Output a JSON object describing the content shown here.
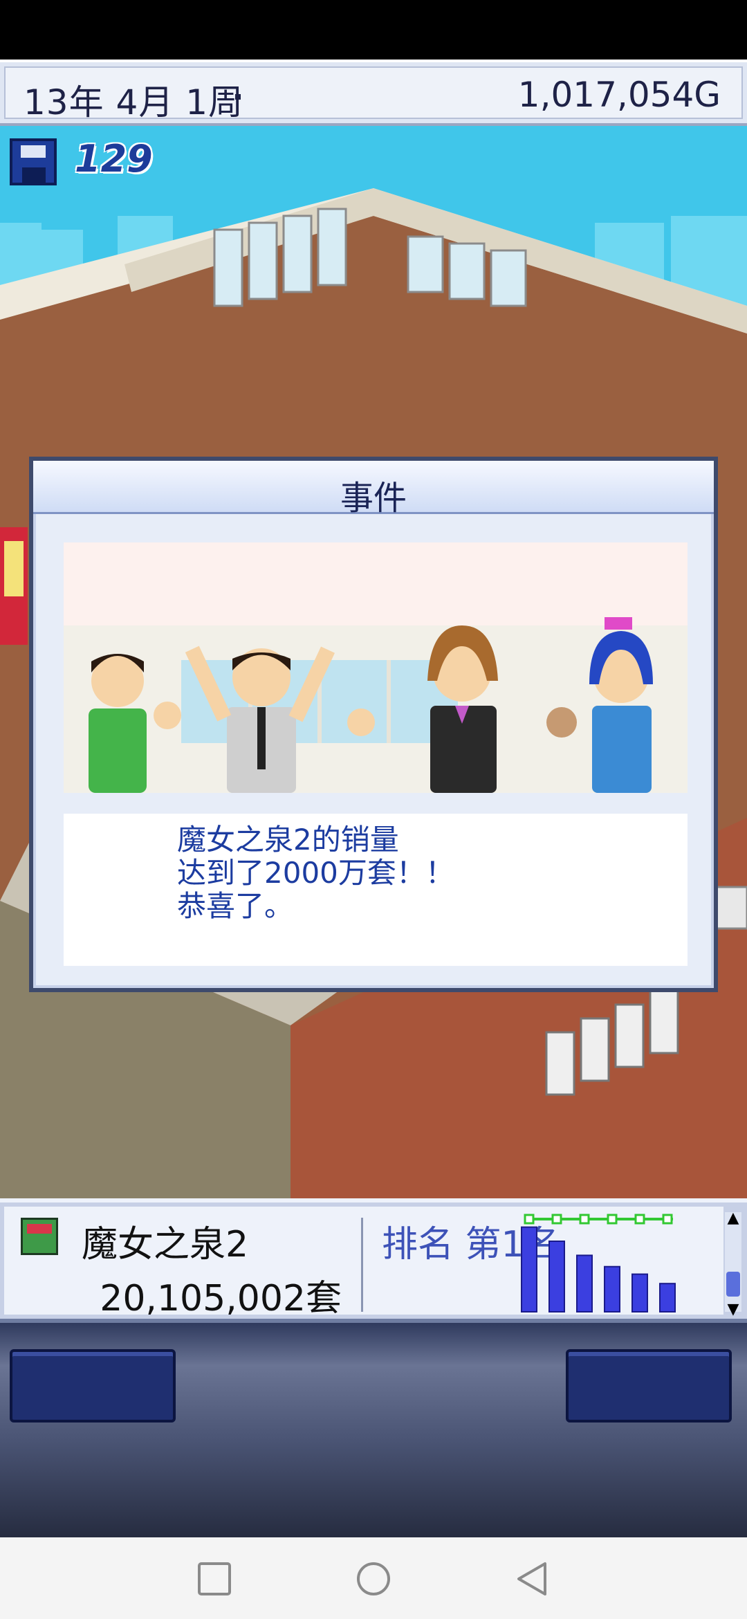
{
  "top_bar": {
    "date": "13年 4月 1周",
    "money": "1,017,054G"
  },
  "save": {
    "icon": "floppy-disk-icon",
    "count": "129"
  },
  "event_dialog": {
    "title": "事件",
    "message_lines": [
      "魔女之泉2的销量",
      "达到了2000万套！！",
      "恭喜了。"
    ]
  },
  "sales_panel": {
    "game_title": "魔女之泉2",
    "units_sold": "20,105,002套",
    "ranking": "排名 第1名",
    "chart_values": [
      90,
      75,
      60,
      48,
      40,
      30
    ]
  },
  "colors": {
    "sky": "#40c6ea",
    "dialog_text": "#1c3ca0",
    "rank_text": "#3d52b8",
    "bar_fill": "#3b3fe0"
  }
}
